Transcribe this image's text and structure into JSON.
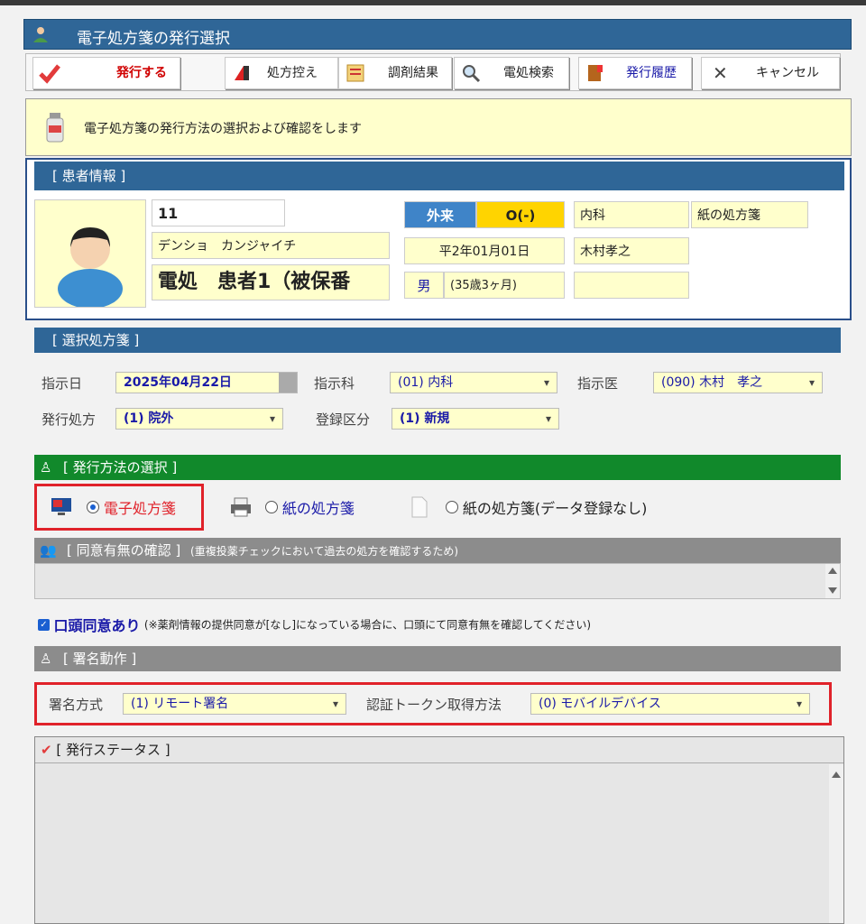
{
  "window": {
    "title": "電子処方箋の発行選択"
  },
  "toolbar": {
    "issue": "発行する",
    "copy": "処方控え",
    "dispense_result": "調剤結果",
    "search": "電処検索",
    "history": "発行履歴",
    "cancel": "キャンセル"
  },
  "info": {
    "message": "電子処方箋の発行方法の選択および確認をします"
  },
  "patient": {
    "section_title": "[ 患者情報 ]",
    "id": "11",
    "kana": "デンショ　カンジャイチ",
    "name": "電処　患者1（被保番",
    "visit_type": "外来",
    "visit_code": "O(-)",
    "birthdate": "平2年01月01日",
    "sex": "男",
    "age": "(35歳3ヶ月)",
    "department": "内科",
    "doctor": "木村孝之",
    "prescription_type": "紙の処方箋"
  },
  "selected": {
    "section_title": "[ 選択処方箋 ]",
    "date_label": "指示日",
    "date_value": "2025年04月22日",
    "dept_label": "指示科",
    "dept_value": "(01) 内科",
    "doctor_label": "指示医",
    "doctor_value": "(090) 木村　孝之",
    "issue_label": "発行処方",
    "issue_value": "(1) 院外",
    "reg_label": "登録区分",
    "reg_value": "(1) 新規"
  },
  "method": {
    "section_title": "[ 発行方法の選択 ]",
    "options": [
      "電子処方箋",
      "紙の処方箋",
      "紙の処方箋(データ登録なし)"
    ],
    "selected_index": 0
  },
  "consent": {
    "section_title": "[ 同意有無の確認 ]",
    "section_note": "(重複投薬チェックにおいて過去の処方を確認するため)",
    "checkbox_label": "口頭同意あり",
    "checkbox_note": "(※薬剤情報の提供同意が[なし]になっている場合に、口頭にて同意有無を確認してください)",
    "checked": true
  },
  "signature": {
    "section_title": "[ 署名動作 ]",
    "method_label": "署名方式",
    "method_value": "(1) リモート署名",
    "token_label": "認証トークン取得方法",
    "token_value": "(0) モバイルデバイス"
  },
  "status": {
    "section_title": "[ 発行ステータス ]"
  },
  "colors": {
    "header_blue": "#2f6697",
    "green": "#11892b",
    "highlight_red": "#e0222a",
    "info_yellow": "#ffffcc"
  }
}
